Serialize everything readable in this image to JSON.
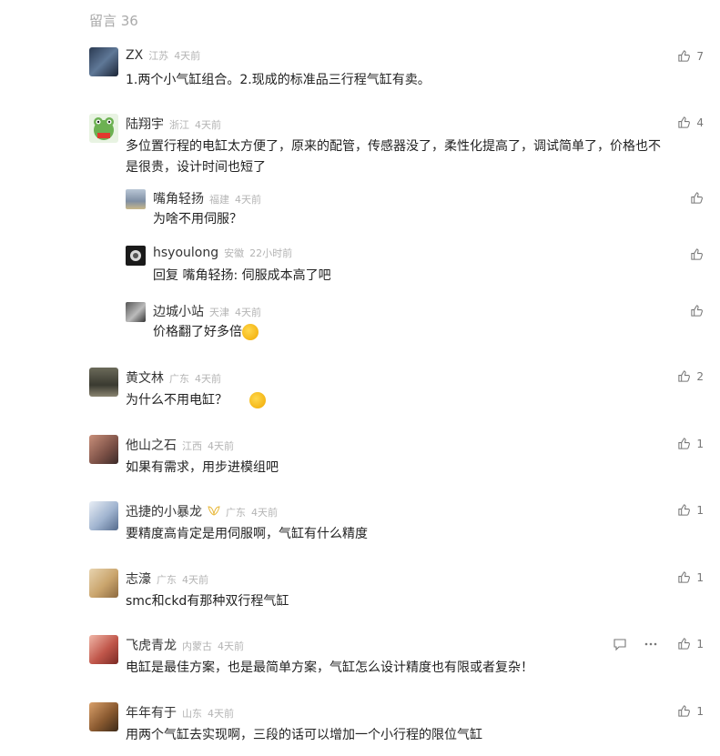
{
  "header": {
    "title": "留言 36"
  },
  "comments": [
    {
      "name": "ZX",
      "region": "江苏",
      "time": "4天前",
      "text": "1.两个小气缸组合。2.现成的标准品三行程气缸有卖。",
      "likes": "7"
    },
    {
      "name": "陆翔宇",
      "region": "浙江",
      "time": "4天前",
      "text1": "多位置行程的电缸太方便了，原来的配管，传感器没了，柔性化提高了，调试简单了，价格也不",
      "text2": "是很贵，设计时间也短了",
      "likes": "4"
    },
    {
      "name": "黄文林",
      "region": "广东",
      "time": "4天前",
      "text": "为什么不用电缸？",
      "likes": "2"
    },
    {
      "name": "他山之石",
      "region": "江西",
      "time": "4天前",
      "text": "如果有需求，用步进模组吧",
      "likes": "1"
    },
    {
      "name": "迅捷的小暴龙",
      "region": "广东",
      "time": "4天前",
      "text": "要精度高肯定是用伺服啊，气缸有什么精度",
      "likes": "1"
    },
    {
      "name": "志濠",
      "region": "广东",
      "time": "4天前",
      "text": "smc和ckd有那种双行程气缸",
      "likes": "1"
    },
    {
      "name": "飞虎青龙",
      "region": "内蒙古",
      "time": "4天前",
      "text": "电缸是最佳方案，也是最简单方案，气缸怎么设计精度也有限或者复杂！",
      "likes": "1"
    },
    {
      "name": "年年有于",
      "region": "山东",
      "time": "4天前",
      "text": "用两个气缸去实现啊，三段的话可以增加一个小行程的限位气缸",
      "likes": "1"
    }
  ],
  "replies": [
    {
      "name": "嘴角轻扬",
      "region": "福建",
      "time": "4天前",
      "text": "为啥不用伺服？"
    },
    {
      "name": "hsyoulong",
      "region": "安徽",
      "time": "22小时前",
      "text": "回复 嘴角轻扬: 伺服成本高了吧"
    },
    {
      "name": "边城小站",
      "region": "天津",
      "time": "4天前",
      "text": "价格翻了好多倍"
    }
  ],
  "icons": {
    "like": "thumbs-up-icon",
    "comment": "comment-icon",
    "more": "more-icon"
  }
}
